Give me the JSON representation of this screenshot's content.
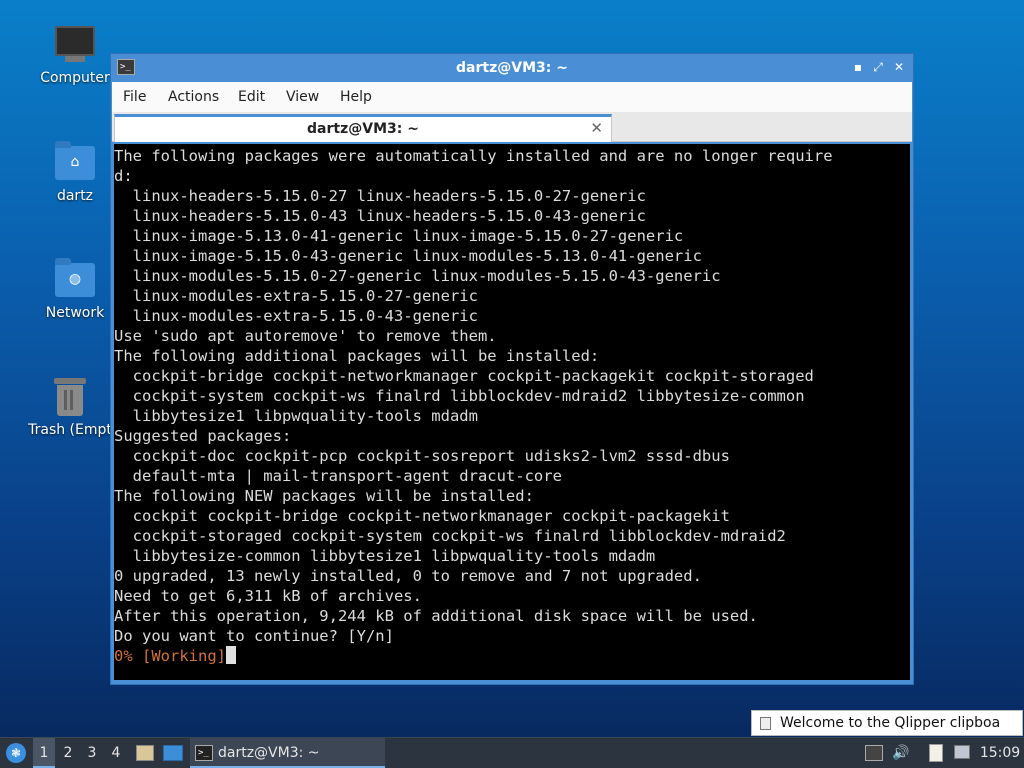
{
  "desktop": {
    "icons": [
      {
        "label": "Computer",
        "icon": "computer-icon"
      },
      {
        "label": "dartz",
        "icon": "home-folder-icon"
      },
      {
        "label": "Network",
        "icon": "network-folder-icon"
      },
      {
        "label": "Trash (Empt",
        "icon": "trash-icon"
      }
    ]
  },
  "window": {
    "title": "dartz@VM3: ~",
    "controls": {
      "minimize": "▪",
      "maximize": "⤢",
      "close": "✕"
    },
    "menu": [
      "File",
      "Actions",
      "Edit",
      "View",
      "Help"
    ],
    "tab": {
      "label": "dartz@VM3: ~",
      "close": "✕"
    },
    "terminal": {
      "lines": [
        "The following packages were automatically installed and are no longer require",
        "d:",
        "  linux-headers-5.15.0-27 linux-headers-5.15.0-27-generic",
        "  linux-headers-5.15.0-43 linux-headers-5.15.0-43-generic",
        "  linux-image-5.13.0-41-generic linux-image-5.15.0-27-generic",
        "  linux-image-5.15.0-43-generic linux-modules-5.13.0-41-generic",
        "  linux-modules-5.15.0-27-generic linux-modules-5.15.0-43-generic",
        "  linux-modules-extra-5.15.0-27-generic",
        "  linux-modules-extra-5.15.0-43-generic",
        "Use 'sudo apt autoremove' to remove them.",
        "The following additional packages will be installed:",
        "  cockpit-bridge cockpit-networkmanager cockpit-packagekit cockpit-storaged",
        "  cockpit-system cockpit-ws finalrd libblockdev-mdraid2 libbytesize-common",
        "  libbytesize1 libpwquality-tools mdadm",
        "Suggested packages:",
        "  cockpit-doc cockpit-pcp cockpit-sosreport udisks2-lvm2 sssd-dbus",
        "  default-mta | mail-transport-agent dracut-core",
        "The following NEW packages will be installed:",
        "  cockpit cockpit-bridge cockpit-networkmanager cockpit-packagekit",
        "  cockpit-storaged cockpit-system cockpit-ws finalrd libblockdev-mdraid2",
        "  libbytesize-common libbytesize1 libpwquality-tools mdadm",
        "0 upgraded, 13 newly installed, 0 to remove and 7 not upgraded.",
        "Need to get 6,311 kB of archives.",
        "After this operation, 9,244 kB of additional disk space will be used.",
        "Do you want to continue? [Y/n]"
      ],
      "progress_line": "0% [Working]"
    }
  },
  "notification": {
    "text": "Welcome to the Qlipper clipboa",
    "icon": "clipboard-icon"
  },
  "taskbar": {
    "workspaces": [
      "1",
      "2",
      "3",
      "4"
    ],
    "active_workspace": "1",
    "task": {
      "label": "dartz@VM3: ~"
    },
    "tray": {
      "volume_icon": "🔊",
      "clock": "15:09"
    }
  },
  "colors": {
    "window_accent": "#4a8fd6",
    "terminal_bg": "#000000",
    "progress_text": "#d4703a"
  }
}
